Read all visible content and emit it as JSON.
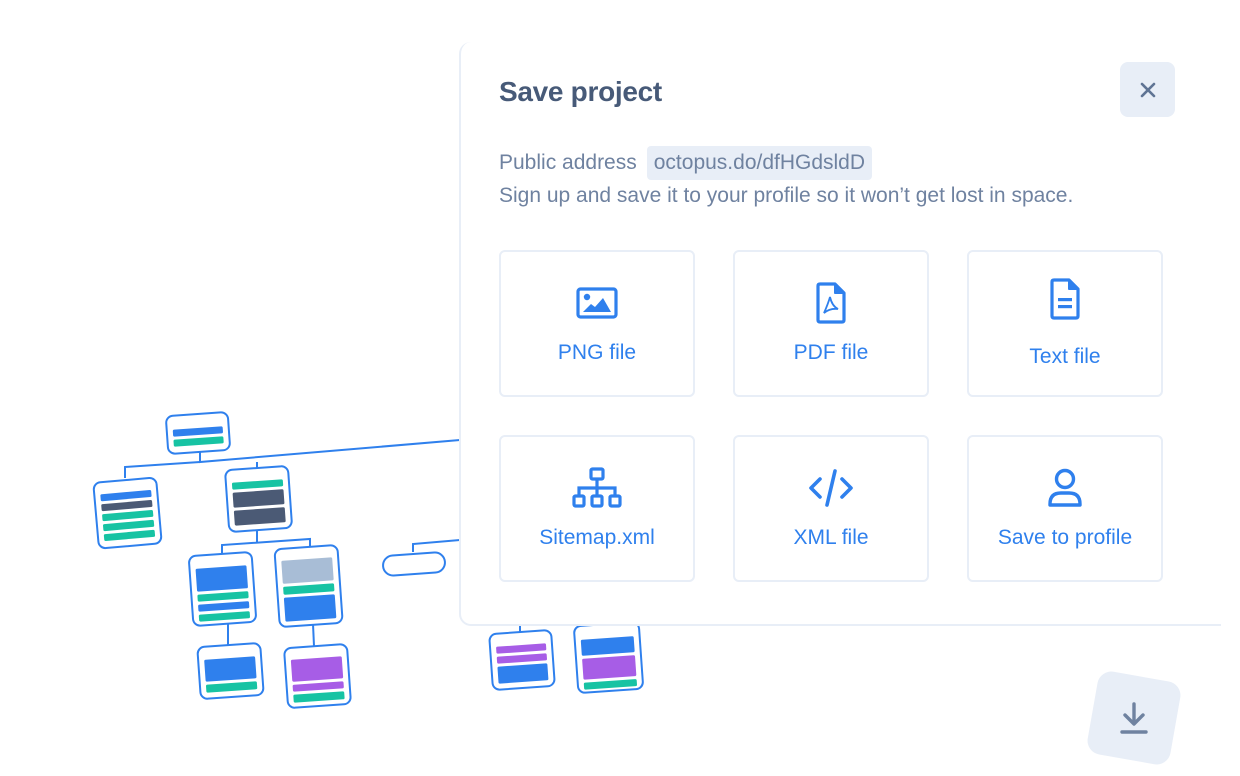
{
  "dialog": {
    "title": "Save project",
    "close_label": "close",
    "public_address_label": "Public address",
    "public_address_value": "octopus.do/dfHGdsldD",
    "hint": "Sign up and save it to your profile so it won’t get lost in space."
  },
  "export_options": [
    {
      "label": "PNG file",
      "icon": "image-icon"
    },
    {
      "label": "PDF file",
      "icon": "pdf-file-icon"
    },
    {
      "label": "Text file",
      "icon": "text-file-icon"
    },
    {
      "label": "Sitemap.xml",
      "icon": "sitemap-icon"
    },
    {
      "label": "XML file",
      "icon": "code-icon"
    },
    {
      "label": "Save to profile",
      "icon": "user-icon"
    }
  ],
  "download_button": {
    "icon": "download-icon"
  },
  "colors": {
    "accent": "#2f80ed",
    "text_muted": "#6f82a0",
    "title": "#475a78",
    "surface": "#e8eef7",
    "green": "#17c3a3",
    "dark": "#4b5a75",
    "purple": "#a75de6",
    "grey_blue": "#a8bdd6"
  }
}
